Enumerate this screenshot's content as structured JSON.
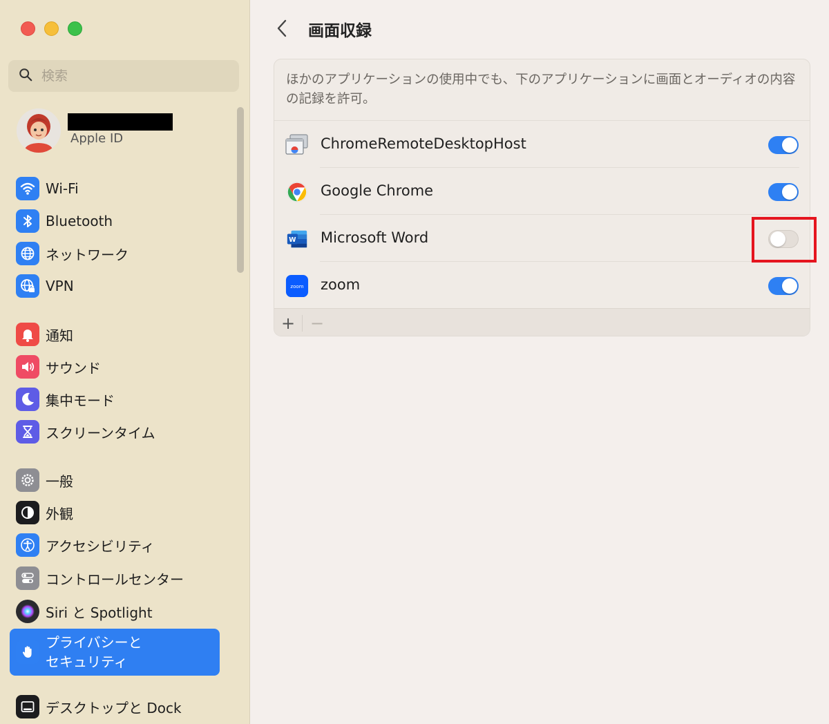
{
  "window": {
    "traffic_lights": [
      "close",
      "minimize",
      "zoom"
    ]
  },
  "sidebar": {
    "search": {
      "placeholder": "検索",
      "value": ""
    },
    "account": {
      "label": "Apple ID"
    },
    "items": [
      {
        "label": "Wi-Fi",
        "icon": "wifi-icon",
        "color": "#2f80f3"
      },
      {
        "label": "Bluetooth",
        "icon": "bluetooth-icon",
        "color": "#2f80f3"
      },
      {
        "label": "ネットワーク",
        "icon": "globe-icon",
        "color": "#2f80f3"
      },
      {
        "label": "VPN",
        "icon": "vpn-globe-icon",
        "color": "#2f80f3"
      },
      {
        "label": "通知",
        "icon": "bell-icon",
        "color": "#ef4b46"
      },
      {
        "label": "サウンド",
        "icon": "speaker-icon",
        "color": "#ef4b64"
      },
      {
        "label": "集中モード",
        "icon": "moon-icon",
        "color": "#5e5ce6"
      },
      {
        "label": "スクリーンタイム",
        "icon": "hourglass-icon",
        "color": "#5e5ce6"
      },
      {
        "label": "一般",
        "icon": "gear-icon",
        "color": "#8e8e93"
      },
      {
        "label": "外観",
        "icon": "appearance-icon",
        "color": "#1c1c1e"
      },
      {
        "label": "アクセシビリティ",
        "icon": "accessibility-icon",
        "color": "#2f80f3"
      },
      {
        "label": "コントロールセンター",
        "icon": "control-center-icon",
        "color": "#8e8e93"
      },
      {
        "label": "Siri と Spotlight",
        "icon": "siri-icon",
        "color": "#333333"
      },
      {
        "label": "プライバシーと\nセキュリティ",
        "icon": "hand-icon",
        "color": "#2f80f3",
        "selected": true
      },
      {
        "label": "デスクトップと Dock",
        "icon": "dock-icon",
        "color": "#1c1c1e"
      }
    ]
  },
  "main": {
    "title": "画面収録",
    "description": "ほかのアプリケーションの使用中でも、下のアプリケーションに画面とオーディオの内容の記録を許可。",
    "apps": [
      {
        "name": "ChromeRemoteDesktopHost",
        "icon": "chrome-remote-desktop-icon",
        "enabled": true
      },
      {
        "name": "Google Chrome",
        "icon": "chrome-icon",
        "enabled": true
      },
      {
        "name": "Microsoft Word",
        "icon": "word-icon",
        "enabled": false
      },
      {
        "name": "zoom",
        "icon": "zoom-icon",
        "enabled": true
      }
    ],
    "footer": {
      "add_label": "+",
      "remove_label": "−"
    }
  },
  "colors": {
    "accent": "#2f7ff2",
    "highlight_box": "#e5151f",
    "sidebar_bg": "#ece3c9"
  }
}
